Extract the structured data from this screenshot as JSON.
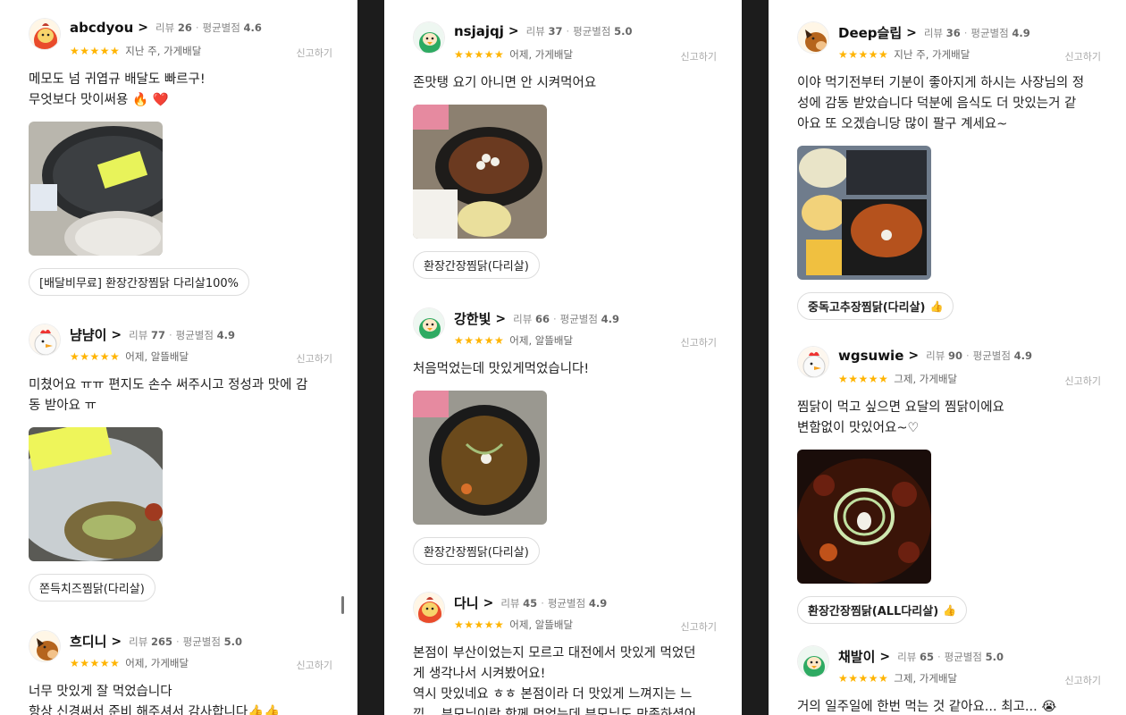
{
  "report_label": "신고하기",
  "review_count_label": "리뷰",
  "avg_rating_label": "평균별점",
  "star_glyphs": "★★★★★",
  "columns": [
    {
      "reviews": [
        {
          "nickname": "abcdyou",
          "review_count": "26",
          "avg_rating": "4.6",
          "when": "지난 주, 가게배달",
          "text_lines": [
            "메모도 넘 귀엽규 배달도 빠르구!",
            "무엇보다 맛이써용 🔥 ❤️"
          ],
          "tag": "[배달비무료] 환장간장찜닭 다리살100%",
          "avatar": "orange-chick-avatar"
        },
        {
          "nickname": "냠냠이",
          "review_count": "77",
          "avg_rating": "4.9",
          "when": "어제, 알뜰배달",
          "text_lines": [
            "미쳤어요 ㅠㅠ 편지도 손수 써주시고 정성과 맛에 감",
            "동 받아요 ㅠ"
          ],
          "tag": "쫀득치즈찜닭(다리살)",
          "avatar": "white-chicken-avatar"
        },
        {
          "nickname": "흐디니",
          "review_count": "265",
          "avg_rating": "5.0",
          "when": "어제, 가게배달",
          "text_lines": [
            "너무 맛있게 잘 먹었습니다",
            "항상 신경써서 준비 해주셔서 감사합니다👍👍"
          ],
          "tag": "",
          "avatar": "horse-avatar"
        }
      ]
    },
    {
      "reviews": [
        {
          "nickname": "nsjajqj",
          "review_count": "37",
          "avg_rating": "5.0",
          "when": "어제, 가게배달",
          "text_lines": [
            "존맛탱 요기 아니면 안 시켜먹어요"
          ],
          "tag": "환장간장찜닭(다리살)",
          "avatar": "green-chick-avatar"
        },
        {
          "nickname": "강한빛",
          "review_count": "66",
          "avg_rating": "4.9",
          "when": "어제, 알뜰배달",
          "text_lines": [
            "처음먹었는데 맛있게먹었습니다!"
          ],
          "tag": "환장간장찜닭(다리살)",
          "avatar": "green-chick-avatar"
        },
        {
          "nickname": "다니",
          "review_count": "45",
          "avg_rating": "4.9",
          "when": "어제, 알뜰배달",
          "text_lines": [
            "본점이 부산이었는지 모르고 대전에서 맛있게 먹었던",
            "게 생각나서 시켜봤어요!",
            "역시 맛있네요 ㅎㅎ 본점이라 더 맛있게 느껴지는 느",
            "낌... 부모님이랑 함께 먹었는데 부모님도 만족하셨어"
          ],
          "tag": "",
          "avatar": "orange-chick-avatar"
        }
      ]
    },
    {
      "reviews": [
        {
          "nickname": "Deep슬립",
          "review_count": "36",
          "avg_rating": "4.9",
          "when": "지난 주, 가게배달",
          "text_lines": [
            "이야 먹기전부터 기분이 좋아지게 하시는 사장님의 정",
            "성에 감동 받았습니다  덕분에 음식도 더 맛있는거 같",
            "아요 또 오겠습니당 많이 팔구 계세요~"
          ],
          "tag": "중독고추장찜닭(다리살)",
          "tag_thumb": "👍",
          "avatar": "horse-avatar"
        },
        {
          "nickname": "wgsuwie",
          "review_count": "90",
          "avg_rating": "4.9",
          "when": "그제, 가게배달",
          "text_lines": [
            "찜닭이 먹고 싶으면 요달의 찜닭이에요",
            "변함없이 맛있어요~♡"
          ],
          "tag": "환장간장찜닭(ALL다리살)",
          "tag_thumb": "👍",
          "avatar": "white-chicken-avatar"
        },
        {
          "nickname": "채발이",
          "review_count": "65",
          "avg_rating": "5.0",
          "when": "그제, 가게배달",
          "text_lines": [
            "거의 일주일에 한번 먹는 것 같아요... 최고... 😭"
          ],
          "tag": "",
          "avatar": "green-chick-avatar"
        }
      ]
    }
  ]
}
